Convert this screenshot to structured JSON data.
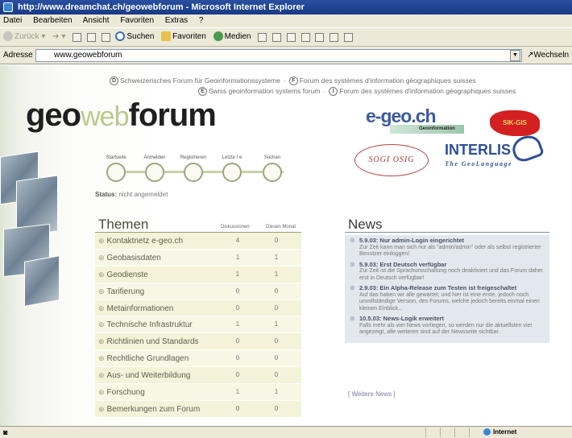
{
  "window": {
    "title": "http://www.dreamchat.ch/geowebforum - Microsoft Internet Explorer"
  },
  "menu": [
    "Datei",
    "Bearbeiten",
    "Ansicht",
    "Favoriten",
    "Extras",
    "?"
  ],
  "toolbar": {
    "back": "Zurück",
    "search": "Suchen",
    "favorites": "Favoriten",
    "media": "Medien"
  },
  "address": {
    "label": "Adresse",
    "value": "www.geowebforum",
    "go": "Wechseln"
  },
  "site": {
    "links_row1": [
      "Schweizerisches Forum für Geoinformationssysteme",
      "Forum des systèmes d'information géographiques suisses"
    ],
    "links_row2": [
      "Swiss geoinformation systems forum",
      "Forum des systèmes d'information géographiques suisses"
    ],
    "logo": {
      "a": "geo",
      "b": "web",
      "c": "forum"
    },
    "nav": [
      "Startseite",
      "Anmelden",
      "Registrieren",
      "Letzte /",
      "e",
      "Suchen"
    ],
    "status_label": "Status:",
    "status_value": "nicht angemeldet",
    "partners": {
      "egeo": "e-geo.ch",
      "egeo_sub": "Geoinformation",
      "swiss": "SIK-GIS",
      "sogi": "SOGI   OSIG",
      "interlis": "INTERLIS",
      "interlis_sub": "The GeoLanguage"
    }
  },
  "themen": {
    "title": "Themen",
    "col1": "Diskussionen",
    "col2": "Diesen Monat",
    "rows": [
      {
        "name": "Kontaktnetz e-geo.ch",
        "d": "4",
        "m": "0"
      },
      {
        "name": "Geobasisdaten",
        "d": "1",
        "m": "1"
      },
      {
        "name": "Geodienste",
        "d": "1",
        "m": "1"
      },
      {
        "name": "Tarifierung",
        "d": "0",
        "m": "0"
      },
      {
        "name": "Metainformationen",
        "d": "0",
        "m": "0"
      },
      {
        "name": "Technische Infrastruktur",
        "d": "1",
        "m": "1"
      },
      {
        "name": "Richtlinien und Standards",
        "d": "0",
        "m": "0"
      },
      {
        "name": "Rechtliche Grundlagen",
        "d": "0",
        "m": "0"
      },
      {
        "name": "Aus- und Weiterbildung",
        "d": "0",
        "m": "0"
      },
      {
        "name": "Forschung",
        "d": "1",
        "m": "1"
      },
      {
        "name": "Bemerkungen zum Forum",
        "d": "0",
        "m": "0"
      }
    ]
  },
  "news": {
    "title": "News",
    "items": [
      {
        "h": "5.9.03: Nur admin-Login eingerichtet",
        "t": "Zur Zeit kann man sich nur als \"admin/admin\" oder als selbst registrierter Benutzer einloggen!"
      },
      {
        "h": "5.9.03: Erst Deutsch verfügbar",
        "t": "Zur Zeit ist die Sprachumschaltung noch deaktiviert und das Forum daher erst in Deutsch verfügbar!"
      },
      {
        "h": "2.9.03: Ein Alpha-Release zum Testen ist freigeschaltet",
        "t": "Auf das haben wir alle gewartet; und hier ist eine erste, jedoch noch unvollständige Version, des Forums, welche jedoch bereits einmal einen kleinen Einblick..."
      },
      {
        "h": "10.5.03: News-Logik erweitert",
        "t": "Falls mehr als vier News vorliegen, so werden nur die aktuellsten vier angezeigt, alle weiteren sind auf der Newsseite sichtbar."
      }
    ],
    "more": "[ Weitere News ]"
  },
  "statusbar": {
    "zone": "Internet"
  }
}
